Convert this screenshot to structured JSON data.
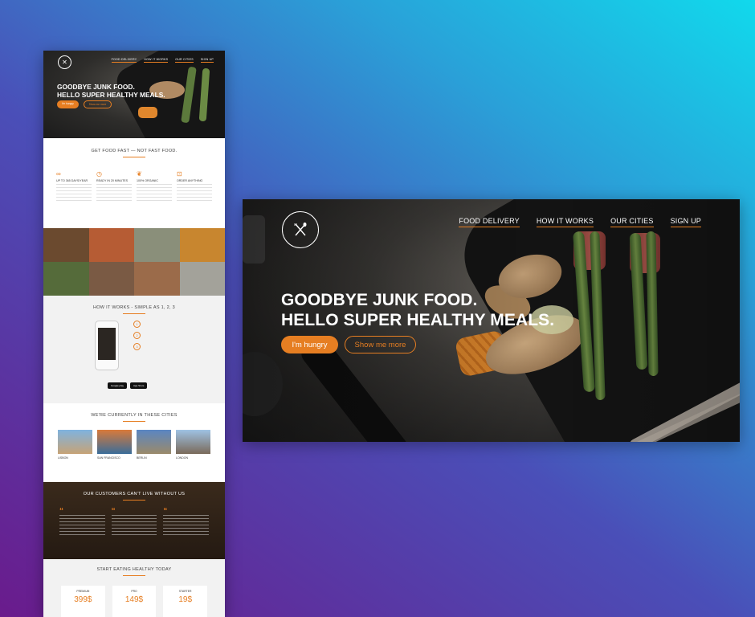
{
  "mockup": {
    "nav": [
      "FOOD DELIVERY",
      "HOW IT WORKS",
      "OUR CITIES",
      "SIGN UP"
    ],
    "headline": [
      "GOODBYE JUNK FOOD.",
      "HELLO SUPER HEALTHY MEALS."
    ],
    "primary_cta": "I'm hungry",
    "secondary_cta": "Show me more",
    "intro_title": "GET FOOD FAST — NOT FAST FOOD.",
    "features": [
      {
        "title": "UP TO 365 DAYS/YEAR"
      },
      {
        "title": "READY IN 20 MINUTES"
      },
      {
        "title": "100% ORGANIC"
      },
      {
        "title": "ORDER ANYTHING"
      }
    ],
    "how_title": "HOW IT WORKS - SIMPLE AS 1, 2, 3",
    "steps": [
      "1",
      "2",
      "3"
    ],
    "stores": [
      "Google play",
      "App Store"
    ],
    "cities_title": "WE'RE CURRENTLY IN THESE CITIES",
    "cities": [
      "LISBON",
      "SAN FRANCISCO",
      "BERLIN",
      "LONDON"
    ],
    "testimonials_title": "OUR CUSTOMERS CAN'T LIVE WITHOUT US",
    "pricing_title": "START EATING HEALTHY TODAY",
    "plans": [
      {
        "name": "PREMIUM",
        "price": "399$"
      },
      {
        "name": "PRO",
        "price": "149$"
      },
      {
        "name": "STARTER",
        "price": "19$"
      }
    ]
  },
  "hero": {
    "logo_icon": "fork-spoon-icon",
    "nav": [
      "FOOD DELIVERY",
      "HOW IT WORKS",
      "OUR CITIES",
      "SIGN UP"
    ],
    "headline_line1": "GOODBYE JUNK FOOD.",
    "headline_line2": "HELLO SUPER HEALTHY MEALS.",
    "primary_cta": "I'm hungry",
    "secondary_cta": "Show me more"
  },
  "colors": {
    "accent": "#e67e22",
    "background_start": "#6a1b8c",
    "background_end": "#11d9ec"
  }
}
